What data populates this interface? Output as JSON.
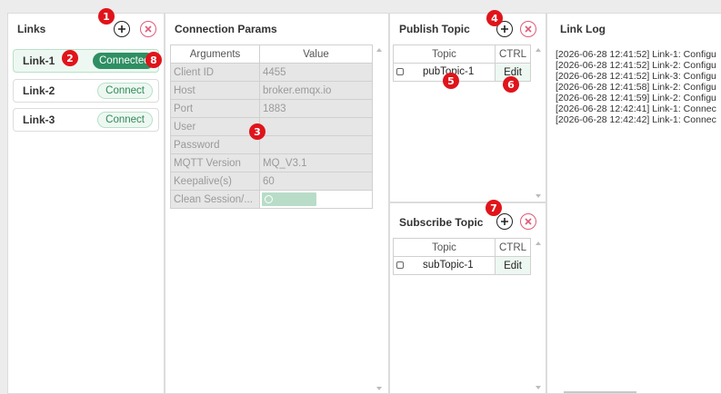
{
  "links": {
    "title": "Links",
    "items": [
      {
        "name": "Link-1",
        "action": "Connected"
      },
      {
        "name": "Link-2",
        "action": "Connect"
      },
      {
        "name": "Link-3",
        "action": "Connect"
      }
    ]
  },
  "connection": {
    "title": "Connection Params",
    "columns": [
      "Arguments",
      "Value"
    ],
    "rows": [
      {
        "arg": "Client ID",
        "value": "4455"
      },
      {
        "arg": "Host",
        "value": "broker.emqx.io"
      },
      {
        "arg": "Port",
        "value": "1883"
      },
      {
        "arg": "User",
        "value": ""
      },
      {
        "arg": "Password",
        "value": ""
      },
      {
        "arg": "MQTT Version",
        "value": "MQ_V3.1"
      },
      {
        "arg": "Keepalive(s)",
        "value": "60"
      },
      {
        "arg": "Clean Session/...",
        "value": ""
      }
    ]
  },
  "publish": {
    "title": "Publish Topic",
    "columns": [
      "Topic",
      "CTRL"
    ],
    "rows": [
      {
        "topic": "pubTopic-1",
        "ctrl": "Edit"
      }
    ]
  },
  "subscribe": {
    "title": "Subscribe Topic",
    "columns": [
      "Topic",
      "CTRL"
    ],
    "rows": [
      {
        "topic": "subTopic-1",
        "ctrl": "Edit"
      }
    ]
  },
  "log": {
    "title": "Link Log",
    "lines": [
      "[2026-06-28 12:41:52] Link-1: Configu",
      "[2026-06-28 12:41:52] Link-2: Configu",
      "[2026-06-28 12:41:52] Link-3: Configu",
      "[2026-06-28 12:41:58] Link-2: Configu",
      "[2026-06-28 12:41:59] Link-2: Configu",
      "[2026-06-28 12:42:41] Link-1: Connec",
      "[2026-06-28 12:42:42] Link-1: Connec"
    ]
  },
  "badges": [
    "1",
    "2",
    "3",
    "4",
    "5",
    "6",
    "7",
    "8"
  ],
  "icons": {
    "add": "plus-circle-icon",
    "close": "x-circle-icon"
  },
  "colors": {
    "accent": "#2e8f63",
    "badge": "#e0141b",
    "close": "#e05a7a"
  }
}
